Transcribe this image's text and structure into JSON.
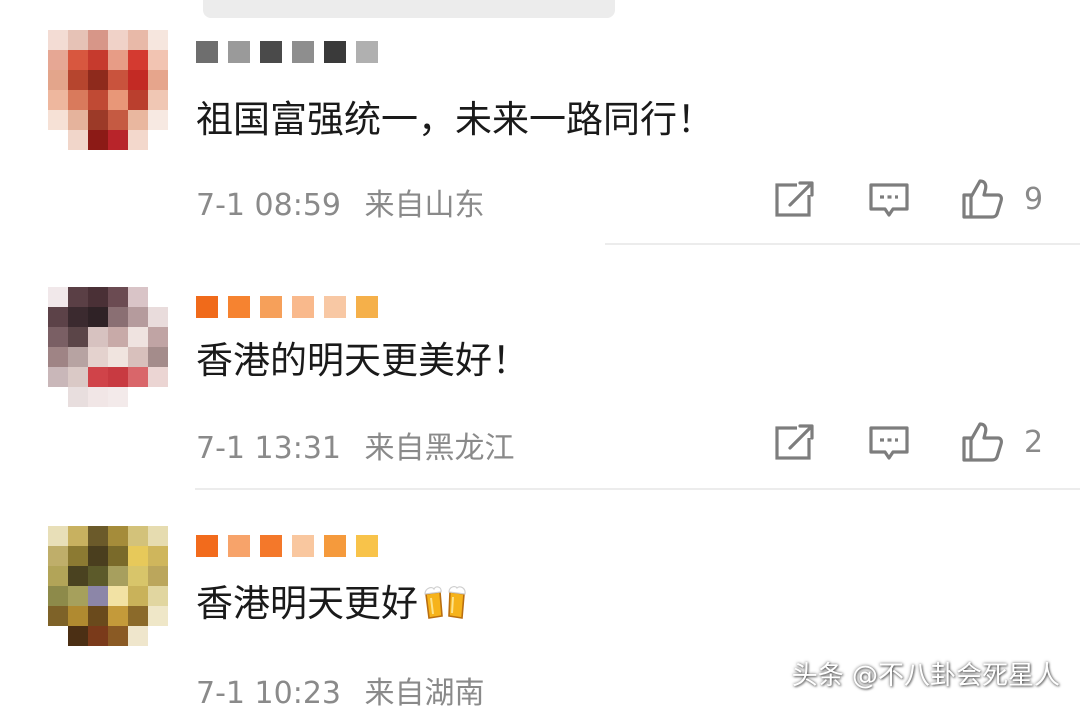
{
  "comments": [
    {
      "text": "祖国富强统一，未来一路同行！",
      "time": "7-1 08:59",
      "location": "来自山东",
      "likes": "9",
      "avatar_colors": [
        "#f3dcd4",
        "#e6c2b6",
        "#d79688",
        "#f0d2c8",
        "#e8b9a8",
        "#f6e6de",
        "#e6a794",
        "#d8573f",
        "#c63a2d",
        "#e79c86",
        "#d43a30",
        "#f2c4b2",
        "#e3a58b",
        "#b6452e",
        "#8e2a1c",
        "#c9533d",
        "#c32a24",
        "#e6a58c",
        "#eeb79e",
        "#d97a5c",
        "#c04a34",
        "#e89778",
        "#ba3f2e",
        "#f0c7b4",
        "#f6e1d6",
        "#e5b39c",
        "#9c3a28",
        "#c55a42",
        "#e9b79f",
        "#f7e9e2",
        "#ffffff",
        "#f1d6ca",
        "#8c1a16",
        "#b8242a",
        "#f3d8cc",
        "#ffffff"
      ],
      "username_colors": [
        "#6e6e6e",
        "#9a9a9a",
        "#4a4a4a",
        "#8e8e8e",
        "#3a3a3a",
        "#b0b0b0"
      ]
    },
    {
      "text": "香港的明天更美好！",
      "time": "7-1 13:31",
      "location": "来自黑龙江",
      "likes": "2",
      "avatar_colors": [
        "#f1e8ea",
        "#5a3f45",
        "#4a3036",
        "#6b4b52",
        "#d9c4c7",
        "#ffffff",
        "#5c4248",
        "#3b2a2f",
        "#2f2226",
        "#8a6f73",
        "#b59b9d",
        "#e9dcdc",
        "#7a5f64",
        "#5b4548",
        "#d7c2c0",
        "#c8aaa8",
        "#efe3e0",
        "#c0a4a4",
        "#9f8485",
        "#b7a3a2",
        "#e4d2ce",
        "#f0e4df",
        "#d8c0bc",
        "#a48c8b",
        "#c9b7b9",
        "#dac9c6",
        "#d04349",
        "#c83a41",
        "#d9666a",
        "#ebd5d3",
        "#ffffff",
        "#e8dede",
        "#f1e6e6",
        "#f3eaea",
        "#ffffff",
        "#ffffff"
      ],
      "username_colors": [
        "#f06a1a",
        "#f68330",
        "#f6a05a",
        "#f9b98c",
        "#f8c8a4",
        "#f5b04a"
      ]
    },
    {
      "text": "香港明天更好",
      "time": "7-1 10:23",
      "location": "来自湖南",
      "likes": "",
      "avatar_colors": [
        "#e8dfb8",
        "#c8b160",
        "#6b5a2a",
        "#a58c3a",
        "#d3c27a",
        "#e6dcb0",
        "#bfae6a",
        "#8c7a32",
        "#4a3e1e",
        "#7a6a2a",
        "#e7c95a",
        "#cfb65c",
        "#b2a458",
        "#4a4220",
        "#5c5a2a",
        "#a79f5e",
        "#d8c56a",
        "#bba65c",
        "#8d8a4a",
        "#a6a05c",
        "#8c86a8",
        "#f2e2a4",
        "#c9b25a",
        "#e1d6a0",
        "#7e6228",
        "#b08a30",
        "#6a4a1c",
        "#c49a3a",
        "#8b6a2a",
        "#efe7c8",
        "#ffffff",
        "#4b2f14",
        "#7a3a1a",
        "#8a5a24",
        "#efe6cc",
        "#ffffff"
      ],
      "username_colors": [
        "#f26b1c",
        "#f7a36a",
        "#f4782a",
        "#f9c79f",
        "#f59a3c",
        "#f8c34a"
      ]
    }
  ],
  "actions": {
    "share_icon": "share-icon",
    "reply_icon": "reply-icon",
    "like_icon": "thumbs-up-icon"
  },
  "watermark": "头条 @不八卦会死星人"
}
